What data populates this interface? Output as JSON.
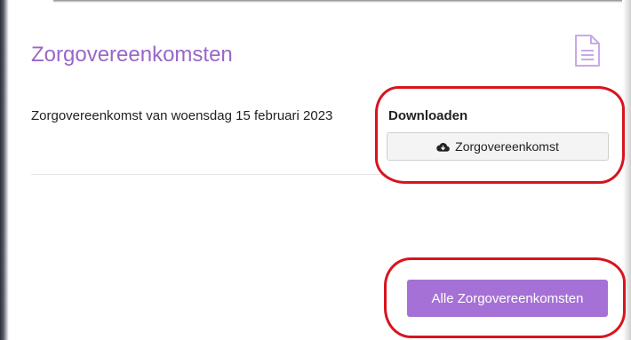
{
  "card": {
    "title": "Zorgovereenkomsten",
    "icon": "document-icon"
  },
  "agreement": {
    "text": "Zorgovereenkomst van woensdag 15 februari 2023",
    "download_heading": "Downloaden",
    "download_button_label": "Zorgovereenkomst",
    "download_button_icon": "cloud-download-icon"
  },
  "footer": {
    "all_button_label": "Alle Zorgovereenkomsten"
  },
  "colors": {
    "accent": "#9a66c8",
    "button_primary": "#a571d6",
    "annotation": "#d8141e"
  }
}
